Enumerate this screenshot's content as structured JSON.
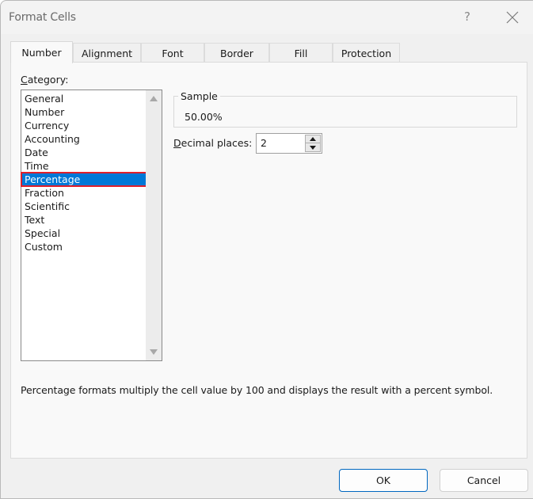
{
  "window": {
    "title": "Format Cells",
    "help_glyph": "?"
  },
  "tabs": [
    {
      "label": "Number",
      "active": true
    },
    {
      "label": "Alignment",
      "active": false
    },
    {
      "label": "Font",
      "active": false
    },
    {
      "label": "Border",
      "active": false
    },
    {
      "label": "Fill",
      "active": false
    },
    {
      "label": "Protection",
      "active": false
    }
  ],
  "category": {
    "label_accel": "C",
    "label_rest": "ategory:",
    "items": [
      "General",
      "Number",
      "Currency",
      "Accounting",
      "Date",
      "Time",
      "Percentage",
      "Fraction",
      "Scientific",
      "Text",
      "Special",
      "Custom"
    ],
    "selected": "Percentage"
  },
  "sample": {
    "label": "Sample",
    "value": "50.00%"
  },
  "decimal_places": {
    "label_accel": "D",
    "label_rest": "ecimal places:",
    "value": "2"
  },
  "description": "Percentage formats multiply the cell value by 100 and displays the result with a percent symbol.",
  "buttons": {
    "ok": "OK",
    "cancel": "Cancel"
  },
  "colors": {
    "selection": "#0078d7",
    "highlight_outline": "#e0202b",
    "primary_border": "#0067c0"
  }
}
